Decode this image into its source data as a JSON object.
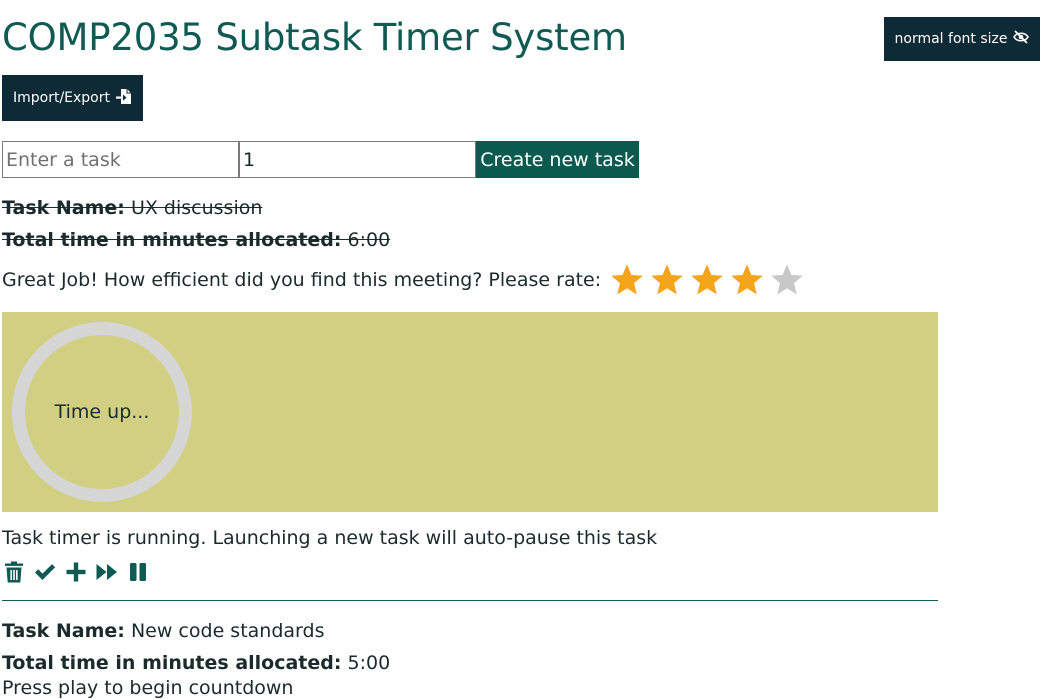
{
  "header": {
    "title": "COMP2035 Subtask Timer System",
    "font_toggle_label": "normal font size",
    "font_toggle_icon": "eye-slash-icon",
    "import_export_label": "Import/Export",
    "import_export_icon": "file-import-icon"
  },
  "new_task_form": {
    "task_placeholder": "Enter a task",
    "task_value": "",
    "minutes_value": "1",
    "create_label": "Create new task"
  },
  "completed_task": {
    "name_label": "Task Name:",
    "name_value": "UX discussion",
    "time_label": "Total time in minutes allocated:",
    "time_value": "6:00",
    "rating_prompt": "Great Job! How efficient did you find this meeting? Please rate:",
    "rating": 4,
    "rating_max": 5,
    "timer_text": "Time up...",
    "status_text": "Task timer is running. Launching a new task will auto-pause this task",
    "actions": [
      "trash-icon",
      "check-icon",
      "plus-icon",
      "fast-forward-icon",
      "pause-icon"
    ]
  },
  "next_task": {
    "name_label": "Task Name:",
    "name_value": "New code standards",
    "time_label": "Total time in minutes allocated:",
    "time_value": "5:00",
    "status_text": "Press play to begin countdown"
  },
  "colors": {
    "title": "#0f5a52",
    "dark_button": "#0e2a36",
    "create_button": "#0b5a4f",
    "timer_panel": "#d1cf82",
    "timer_ring": "#d6d6d6",
    "star_filled": "#f5a51b",
    "star_empty": "#c8c8c8",
    "icon": "#0f5a52"
  }
}
